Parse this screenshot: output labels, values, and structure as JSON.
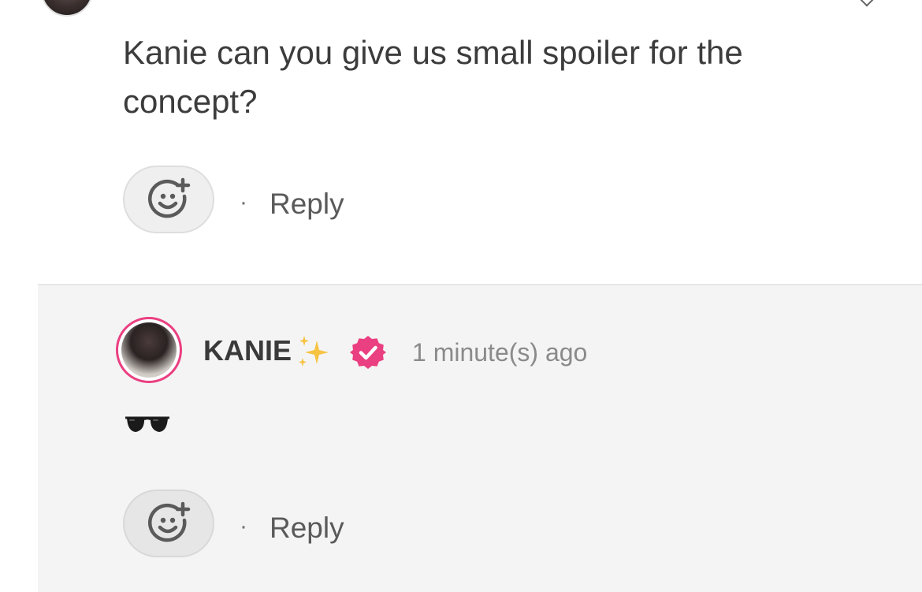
{
  "comment": {
    "text": "Kanie can you give us small spoiler for the concept?",
    "reply_label": "Reply",
    "separator": "·"
  },
  "reply": {
    "username": "KANIE",
    "sparkle_emoji_name": "sparkles-icon",
    "verified": true,
    "timestamp": "1 minute(s) ago",
    "body_emoji_name": "sunglasses-icon",
    "reply_label": "Reply",
    "separator": "·"
  },
  "colors": {
    "accent": "#ea3f80",
    "reply_bg": "#f4f4f4",
    "text": "#3c3c3c",
    "muted": "#8a8a8a"
  }
}
